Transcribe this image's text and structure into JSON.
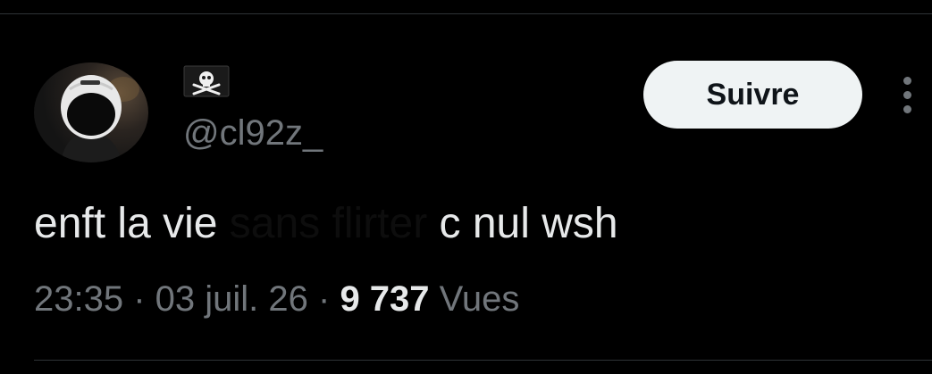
{
  "tweet": {
    "author": {
      "display_name_icon": "pirate-flag-icon",
      "handle": "@cl92z_"
    },
    "follow_label": "Suivre",
    "more_icon": "more-vertical-icon",
    "text": {
      "part1": "enft la vie ",
      "masked": "sans flirter",
      "part2": " c nul wsh"
    },
    "meta": {
      "time": "23:35",
      "separator": " · ",
      "date": "03 juil. 26",
      "views_count": "9 737",
      "views_label": " Vues"
    }
  },
  "colors": {
    "background": "#000000",
    "text_primary": "#e7e9ea",
    "text_secondary": "#71767b",
    "button_bg": "#eff3f4",
    "button_text": "#0f1419",
    "divider": "#2f3336"
  }
}
